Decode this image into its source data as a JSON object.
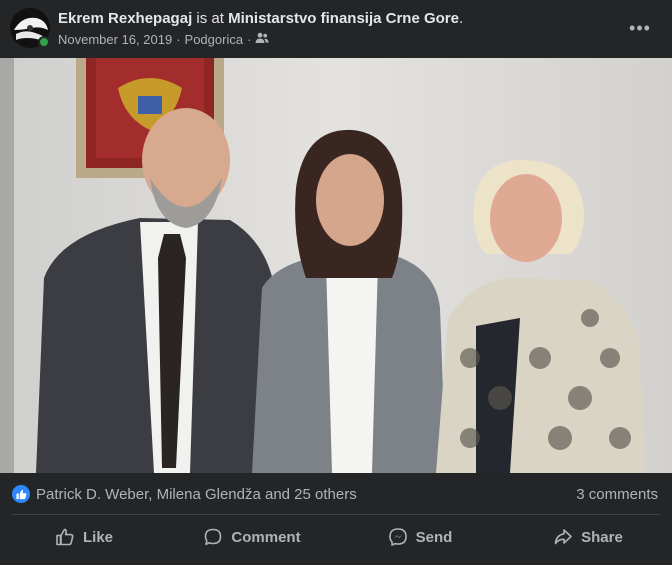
{
  "post": {
    "author": "Ekrem Rexhepagaj",
    "is_at": "is at",
    "place": "Ministarstvo finansija Crne Gore",
    "place_suffix": ".",
    "date": "November 16, 2019",
    "sep1": "·",
    "location": "Podgorica",
    "sep2": "·",
    "privacy_icon": "friends-icon",
    "more_label": "•••"
  },
  "reactions": {
    "icon": "like-reaction-icon",
    "summary": "Patrick D. Weber, Milena Glendža and 25 others",
    "comments": "3 comments"
  },
  "actions": [
    {
      "label": "Like",
      "icon": "thumbs-up-icon"
    },
    {
      "label": "Comment",
      "icon": "comment-icon"
    },
    {
      "label": "Send",
      "icon": "messenger-icon"
    },
    {
      "label": "Share",
      "icon": "share-icon"
    }
  ],
  "colors": {
    "background": "#242526",
    "primary_text": "#e4e6eb",
    "secondary_text": "#b0b3b8",
    "like_blue": "#2d88ff",
    "online_green": "#31a24c"
  }
}
